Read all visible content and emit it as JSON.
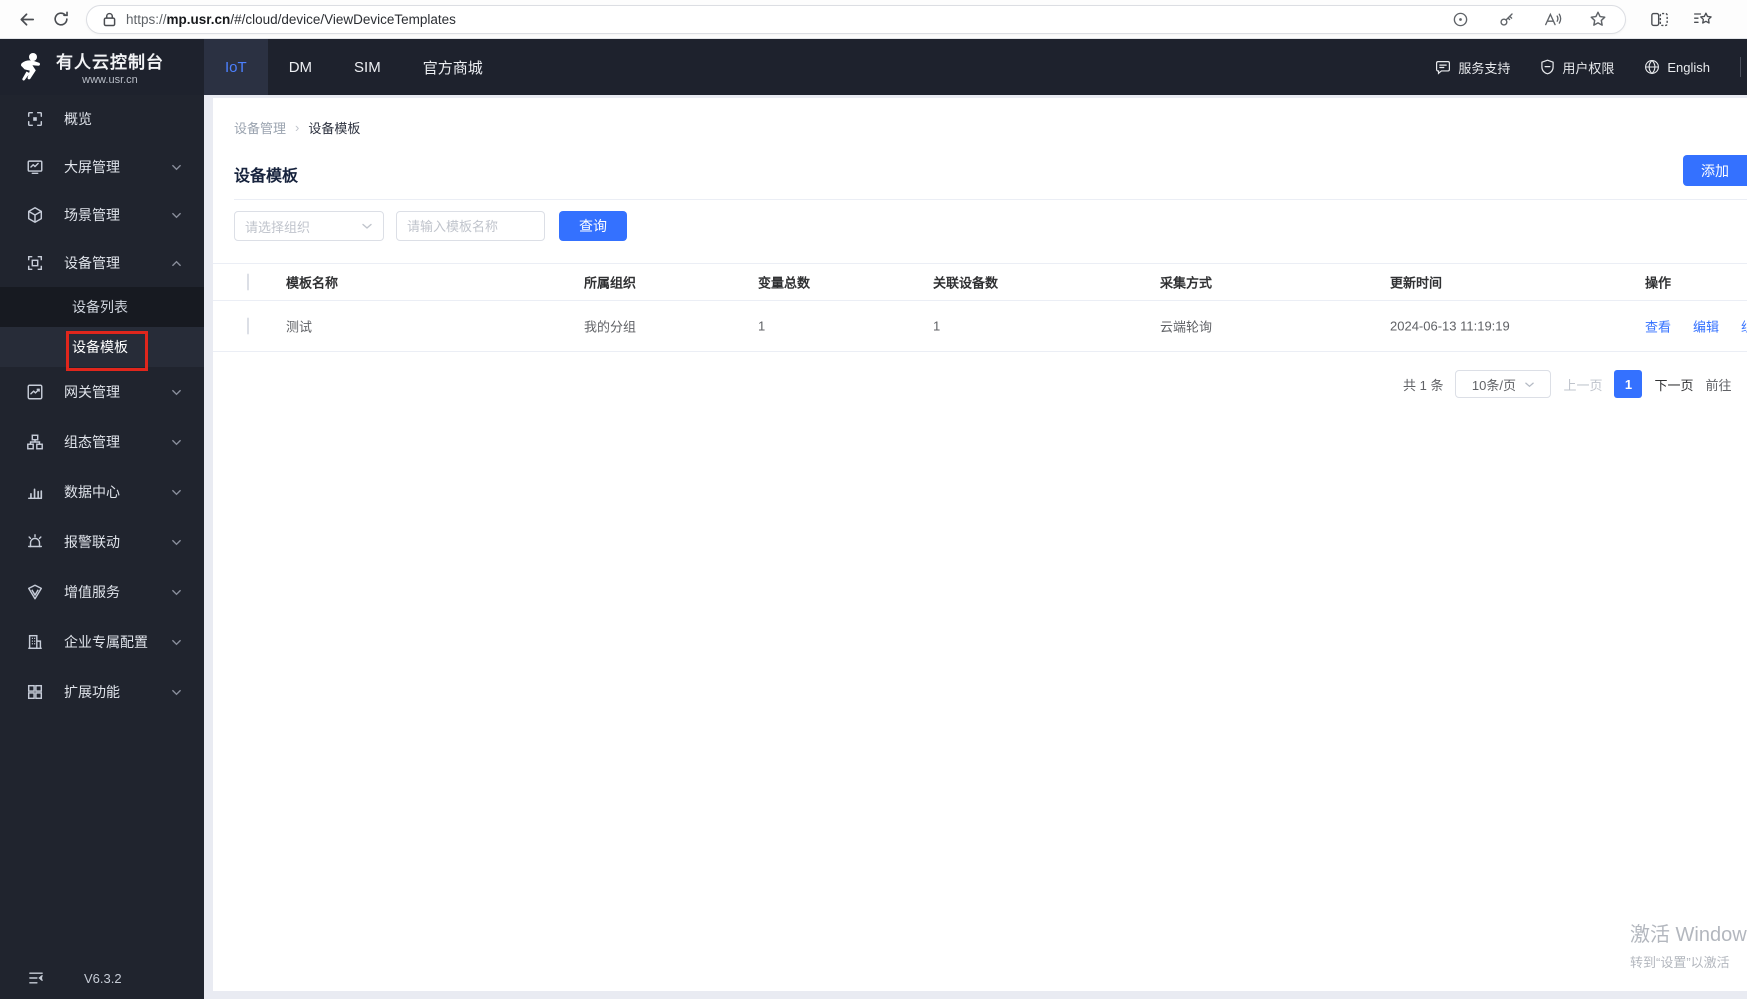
{
  "browser": {
    "url_scheme": "https://",
    "url_host": "mp.usr.cn",
    "url_path": "/#/cloud/device/ViewDeviceTemplates"
  },
  "header": {
    "logo_title": "有人云控制台",
    "logo_subtitle": "www.usr.cn",
    "tabs": [
      {
        "label": "IoT",
        "active": true
      },
      {
        "label": "DM",
        "active": false
      },
      {
        "label": "SIM",
        "active": false
      },
      {
        "label": "官方商城",
        "active": false
      }
    ],
    "support_label": "服务支持",
    "permission_label": "用户权限",
    "language_label": "English"
  },
  "sidebar": {
    "items": [
      {
        "label": "概览"
      },
      {
        "label": "大屏管理"
      },
      {
        "label": "场景管理"
      },
      {
        "label": "设备管理",
        "expanded": true
      },
      {
        "label": "网关管理"
      },
      {
        "label": "组态管理"
      },
      {
        "label": "数据中心"
      },
      {
        "label": "报警联动"
      },
      {
        "label": "增值服务"
      },
      {
        "label": "企业专属配置"
      },
      {
        "label": "扩展功能"
      }
    ],
    "submenu": [
      {
        "label": "设备列表",
        "selected": false
      },
      {
        "label": "设备模板",
        "selected": true
      }
    ],
    "version": "V6.3.2"
  },
  "main": {
    "breadcrumb": [
      "设备管理",
      "设备模板"
    ],
    "breadcrumb_separator": "›",
    "title": "设备模板",
    "add_button": "添加",
    "filters": {
      "org_placeholder": "请选择组织",
      "name_placeholder": "请输入模板名称",
      "search_button": "查询"
    },
    "table": {
      "columns": [
        "模板名称",
        "所属组织",
        "变量总数",
        "关联设备数",
        "采集方式",
        "更新时间",
        "操作"
      ],
      "rows": [
        {
          "name": "测试",
          "org": "我的分组",
          "var_total": "1",
          "device_count": "1",
          "method": "云端轮询",
          "updated": "2024-06-13 11:19:19",
          "action_view": "查看",
          "action_edit": "编辑",
          "action_config": "组态"
        }
      ]
    },
    "pagination": {
      "total": "共 1 条",
      "page_size": "10条/页",
      "prev": "上一页",
      "current": "1",
      "next": "下一页",
      "goto": "前往"
    }
  },
  "watermark": {
    "line1": "激活 Windows",
    "line2": "转到“设置”以激活"
  },
  "colors": {
    "accent": "#3471ff",
    "header_dark": "#1e222d",
    "sidebar_dark": "#20242e",
    "annotation_red": "#e0261c",
    "link_blue": "#3471ff"
  }
}
